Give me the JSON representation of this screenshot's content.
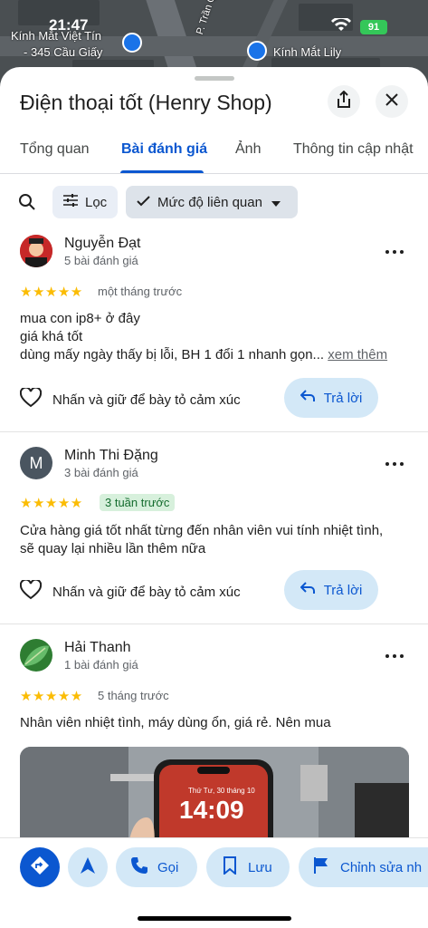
{
  "status_bar": {
    "time": "21:47",
    "battery": "91"
  },
  "map": {
    "labels": [
      "Kính Mắt Việt Tín",
      "- 345 Cầu Giấy",
      "Kính Mắt Lily",
      "P. Trần Quốc"
    ]
  },
  "header": {
    "title": "Điện thoại tốt (Henry Shop)"
  },
  "tabs": [
    {
      "label": "Tổng quan"
    },
    {
      "label": "Bài đánh giá"
    },
    {
      "label": "Ảnh"
    },
    {
      "label": "Thông tin cập nhật"
    }
  ],
  "filters": {
    "filter_label": "Lọc",
    "sort_label": "Mức độ liên quan"
  },
  "reviews": [
    {
      "name": "Nguyễn Đạt",
      "count": "5 bài đánh giá",
      "stars": "★★★★★",
      "rating": 5,
      "when": "một tháng trước",
      "text_lines": [
        "mua con ip8+ ở đây",
        "giá khá tốt",
        "dùng mấy ngày thấy bị lỗi, BH 1 đổi 1 nhanh gọn..."
      ],
      "see_more": "xem thêm",
      "react": "Nhấn và giữ để bày tỏ cảm xúc",
      "reply": "Trả lời"
    },
    {
      "name": "Minh Thi Đặng",
      "initial": "M",
      "count": "3 bài đánh giá",
      "stars": "★★★★★",
      "rating": 5,
      "when": "3 tuần trước",
      "text_lines": [
        "Cửa hàng giá tốt nhất từng đến nhân viên vui tính nhiệt tình,",
        "sẽ quay lại nhiều lần thêm nữa"
      ],
      "react": "Nhấn và giữ để bày tỏ cảm xúc",
      "reply": "Trả lời"
    },
    {
      "name": "Hải Thanh",
      "count": "1 bài đánh giá",
      "stars": "★★★★★",
      "rating": 5,
      "when": "5 tháng trước",
      "text_lines": [
        "Nhân viên nhiệt tình, máy dùng ổn, giá rẻ. Nên mua"
      ],
      "photo": {
        "date": "Thứ Tư, 30 tháng 10",
        "time": "14:09"
      }
    }
  ],
  "bottom_bar": {
    "call": "Gọi",
    "save": "Lưu",
    "edit": "Chỉnh sửa nh"
  },
  "colors": {
    "accent": "#0b57d0",
    "chip": "#d3e8f7",
    "star": "#fbbc04"
  }
}
